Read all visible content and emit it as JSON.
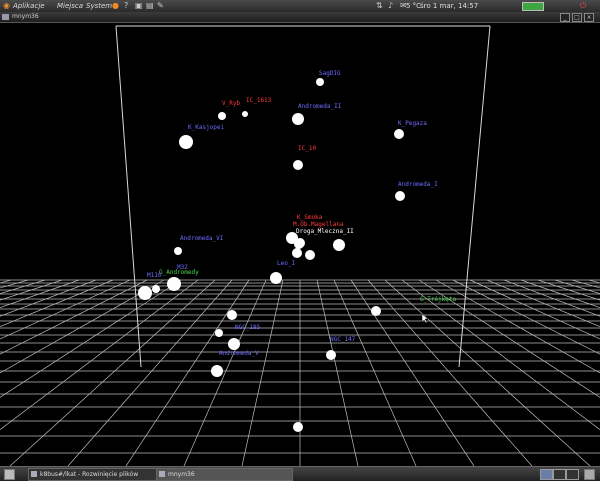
{
  "top_panel": {
    "menus": [
      "Aplikacje",
      "Miejsca",
      "System"
    ],
    "clock": "śro 1 mar, 14:57",
    "weather": "5 °C"
  },
  "window": {
    "title": "mnym36"
  },
  "taskbar": {
    "tasks": [
      {
        "label": "k8bus#/lkat - Rozwinięcie plików"
      },
      {
        "label": "mnym36"
      }
    ]
  },
  "colors": {
    "blue": "#6c6cff",
    "red": "#ff3a3a",
    "green": "#48d848",
    "white": "#ffffff"
  },
  "galaxies": [
    {
      "name": "SagDIG",
      "color": "blue"
    },
    {
      "name": "IC_1613",
      "color": "red"
    },
    {
      "name": "V_Ryb",
      "color": "red"
    },
    {
      "name": "Andromeda_II",
      "color": "blue"
    },
    {
      "name": "K_Kasjopei",
      "color": "blue"
    },
    {
      "name": "K_Pegaza",
      "color": "blue"
    },
    {
      "name": "IC_10",
      "color": "red"
    },
    {
      "name": "Andromeda_I",
      "color": "blue"
    },
    {
      "name": "K_Smoka",
      "color": "red"
    },
    {
      "name": "M.Ob.Magellana",
      "color": "red"
    },
    {
      "name": "Droga_Mleczna_II",
      "color": "white"
    },
    {
      "name": "Andromeda_VI",
      "color": "blue"
    },
    {
      "name": "Leo_I",
      "color": "blue"
    },
    {
      "name": "M32",
      "color": "blue"
    },
    {
      "name": "G_Andromedy",
      "color": "green"
    },
    {
      "name": "M110",
      "color": "blue"
    },
    {
      "name": "G_Trójkąta",
      "color": "green"
    },
    {
      "name": "NGC_185",
      "color": "blue"
    },
    {
      "name": "NGC_147",
      "color": "blue"
    },
    {
      "name": "Andromeda_V",
      "color": "blue"
    }
  ]
}
